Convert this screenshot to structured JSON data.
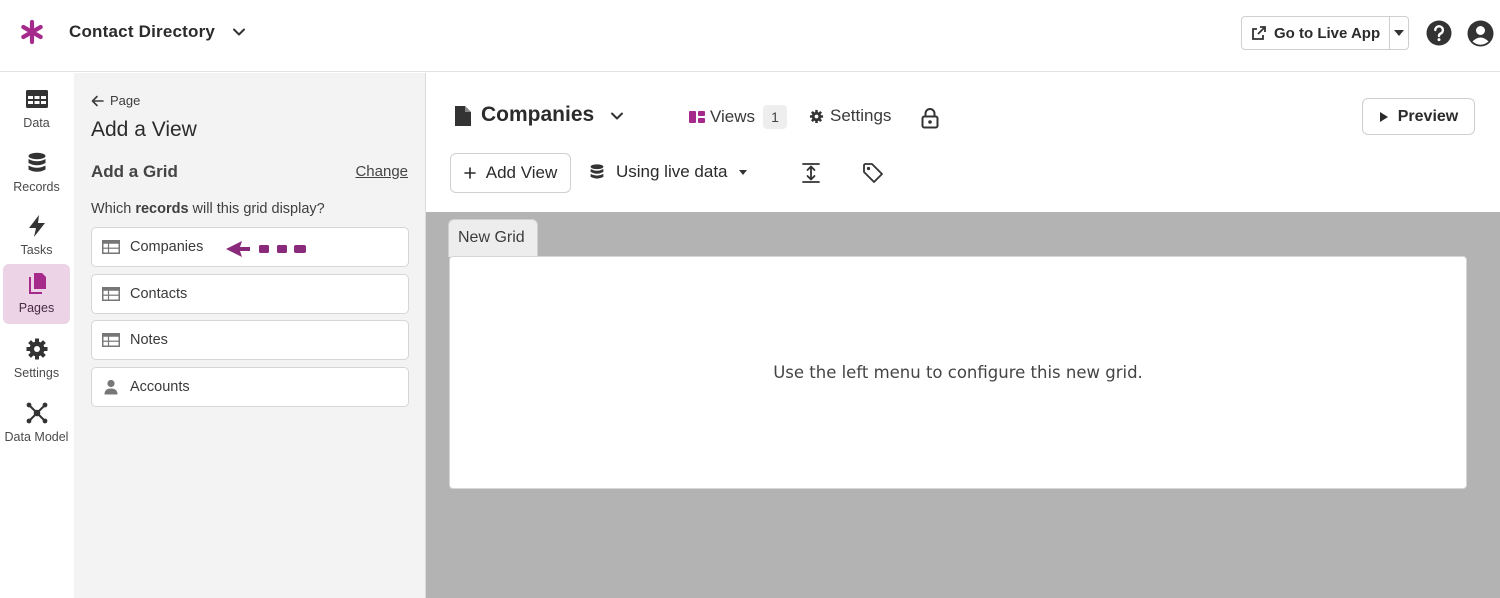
{
  "app": {
    "title": "Contact Directory",
    "go_live_label": "Go to Live App",
    "accent_color": "#a52a8c"
  },
  "rail": {
    "items": [
      {
        "label": "Data",
        "icon": "table-icon"
      },
      {
        "label": "Records",
        "icon": "database-icon"
      },
      {
        "label": "Tasks",
        "icon": "bolt-icon"
      },
      {
        "label": "Pages",
        "icon": "pages-icon",
        "active": true
      },
      {
        "label": "Settings",
        "icon": "gear-icon"
      },
      {
        "label": "Data Model",
        "icon": "network-icon"
      }
    ]
  },
  "panel": {
    "back_label": "Page",
    "title": "Add a View",
    "section_title": "Add a Grid",
    "change_label": "Change",
    "question_prefix": "Which ",
    "question_bold": "records",
    "question_suffix": " will this grid display?",
    "objects": [
      {
        "label": "Companies",
        "icon": "table-icon"
      },
      {
        "label": "Contacts",
        "icon": "table-icon"
      },
      {
        "label": "Notes",
        "icon": "table-icon"
      },
      {
        "label": "Accounts",
        "icon": "user-icon"
      }
    ]
  },
  "main": {
    "page_name": "Companies",
    "views_label": "Views",
    "views_count": "1",
    "settings_label": "Settings",
    "preview_label": "Preview",
    "add_view_label": "Add View",
    "live_data_label": "Using live data",
    "grid_tab_label": "New Grid",
    "grid_message": "Use the left menu to configure this new grid."
  }
}
